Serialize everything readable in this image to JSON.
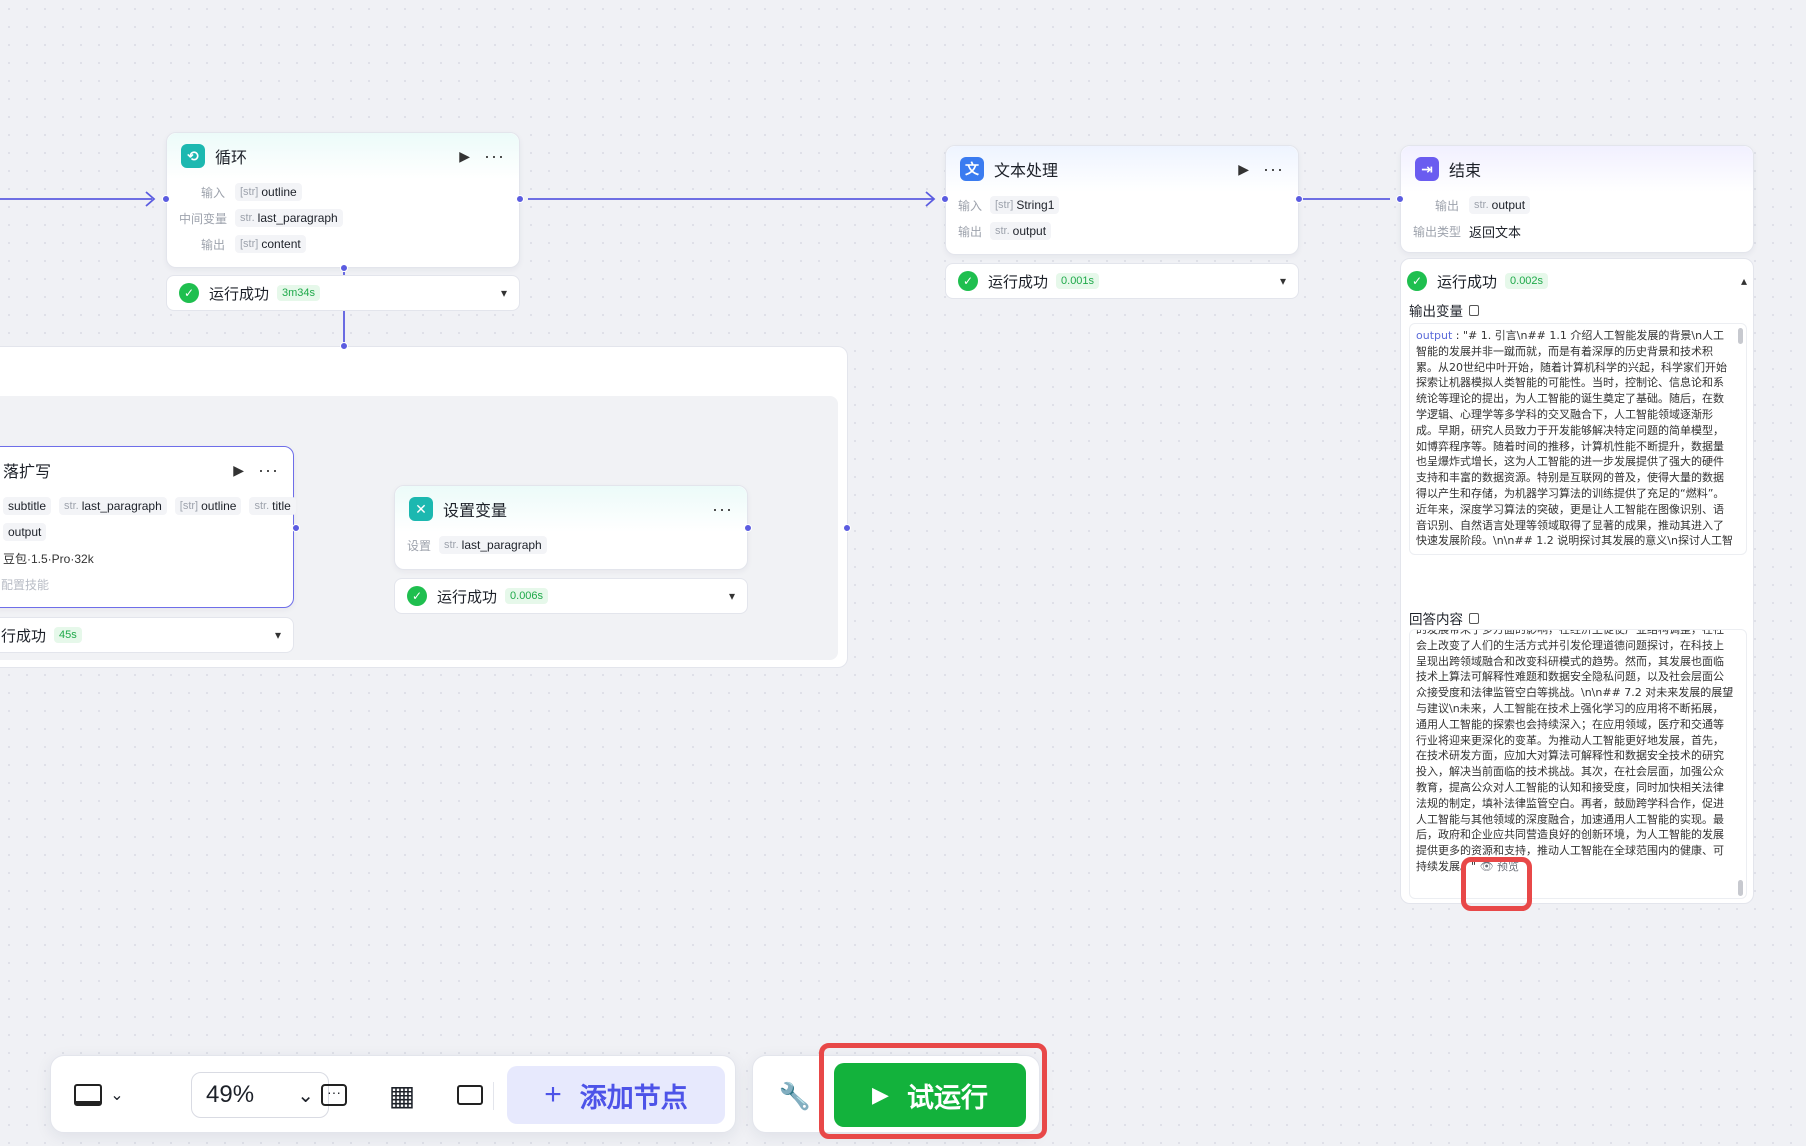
{
  "loop_node": {
    "title": "循环",
    "rows": [
      {
        "label": "输入",
        "tags": [
          {
            "t": "[str]",
            "v": "outline"
          }
        ]
      },
      {
        "label": "中间变量",
        "tags": [
          {
            "t": "str.",
            "v": "last_paragraph"
          }
        ]
      },
      {
        "label": "输出",
        "tags": [
          {
            "t": "[str]",
            "v": "content"
          }
        ]
      }
    ],
    "status": "运行成功",
    "duration": "3m34s"
  },
  "text_node": {
    "title": "文本处理",
    "rows": [
      {
        "label": "输入",
        "tags": [
          {
            "t": "[str]",
            "v": "String1"
          }
        ]
      },
      {
        "label": "输出",
        "tags": [
          {
            "t": "str.",
            "v": "output"
          }
        ]
      }
    ],
    "status": "运行成功",
    "duration": "0.001s"
  },
  "end_node": {
    "title": "结束",
    "rows": [
      {
        "label": "输出",
        "tags": [
          {
            "t": "str.",
            "v": "output"
          }
        ]
      },
      {
        "label": "输出类型",
        "value": "返回文本"
      }
    ],
    "status": "运行成功",
    "duration": "0.002s"
  },
  "expand_node": {
    "title": "落扩写",
    "input_tags": [
      {
        "t": "",
        "v": "subtitle"
      },
      {
        "t": "str.",
        "v": "last_paragraph"
      },
      {
        "t": "[str]",
        "v": "outline"
      },
      {
        "t": "str.",
        "v": "title"
      }
    ],
    "output_tag": "output",
    "model": "豆包·1.5·Pro·32k",
    "skill": "配置技能",
    "status": "行成功",
    "duration": "45s"
  },
  "setvar_node": {
    "title": "设置变量",
    "rows": [
      {
        "label": "设置",
        "tags": [
          {
            "t": "str.",
            "v": "last_paragraph"
          }
        ]
      }
    ],
    "status": "运行成功",
    "duration": "0.006s"
  },
  "output_panel": {
    "vars_title": "输出变量",
    "answer_title": "回答内容",
    "output_key": "output",
    "output_text": " : \"# 1. 引言\\n## 1.1 介绍人工智能发展的背景\\n人工智能的发展并非一蹴而就，而是有着深厚的历史背景和技术积累。从20世纪中叶开始，随着计算机科学的兴起，科学家们开始探索让机器模拟人类智能的可能性。当时，控制论、信息论和系统论等理论的提出，为人工智能的诞生奠定了基础。随后，在数学逻辑、心理学等多学科的交叉融合下，人工智能领域逐渐形成。早期，研究人员致力于开发能够解决特定问题的简单模型，如博弈程序等。随着时间的推移，计算机性能不断提升，数据量也呈爆炸式增长，这为人工智能的进一步发展提供了强大的硬件支持和丰富的数据资源。特别是互联网的普及，使得大量的数据得以产生和存储，为机器学习算法的训练提供了充足的“燃料”。近年来，深度学习算法的突破，更是让人工智能在图像识别、语音识别、自然语言处理等领域取得了显著的成果，推动其进入了快速发展阶段。\\n\\n## 1.2 说明探讨其发展的意义\\n探讨人工智能的发展具有多方面的重要意义。从经济层面来看，人工智能的广泛应用正在引发一场深刻的产业变革，它能够提高生产效率，降低成本，推动传统",
    "answer_text": "的发展带来了多方面的影响，在经济上促使产业结构调整，在社会上改变了人们的生活方式并引发伦理道德问题探讨，在科技上呈现出跨领域融合和改变科研模式的趋势。然而，其发展也面临技术上算法可解释性难题和数据安全隐私问题，以及社会层面公众接受度和法律监管空白等挑战。\\n\\n## 7.2 对未来发展的展望与建议\\n未来，人工智能在技术上强化学习的应用将不断拓展，通用人工智能的探索也会持续深入；在应用领域，医疗和交通等行业将迎来更深化的变革。为推动人工智能更好地发展，首先，在技术研发方面，应加大对算法可解释性和数据安全技术的研究投入，解决当前面临的技术挑战。其次，在社会层面，加强公众教育，提高公众对人工智能的认知和接受度，同时加快相关法律法规的制定，填补法律监管空白。再者，鼓励跨学科合作，促进人工智能与其他领域的深度融合，加速通用人工智能的实现。最后，政府和企业应共同营造良好的创新环境，为人工智能的发展提供更多的资源和支持，推动人工智能在全球范围内的健康、可持续发展。\"",
    "preview_label": "预览"
  },
  "toolbar": {
    "zoom": "49%",
    "add_node": "添加节点",
    "run": "试运行"
  },
  "colors": {
    "edge": "#5b5ce0",
    "success": "#1fbf4f",
    "run_button": "#13b23c",
    "add_node_bg": "#e7e9fd",
    "highlight": "#e84848"
  }
}
